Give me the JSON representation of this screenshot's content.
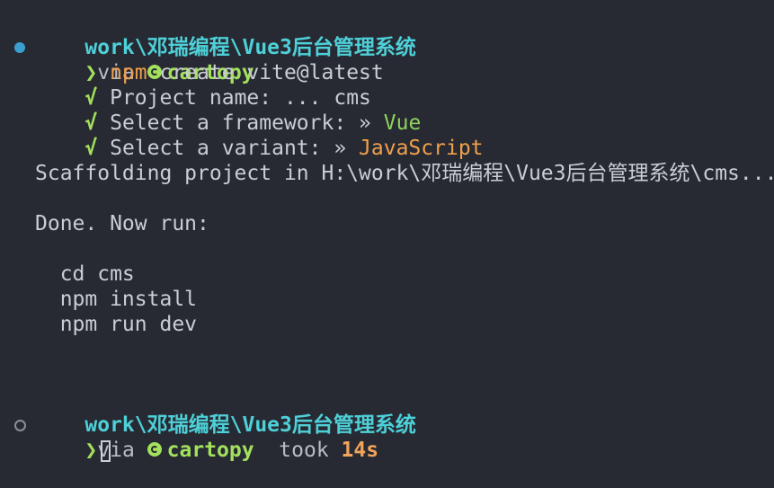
{
  "prompt1": {
    "path": "work\\邓瑞编程\\Vue3后台管理系统",
    "via": "via",
    "env_icon": "python-env-icon",
    "env": "cartopy"
  },
  "cmd": {
    "prompt_char": "❯",
    "program": "npm",
    "args": " create vite@latest"
  },
  "answers": [
    {
      "check": "√",
      "label": " Project name: ... ",
      "value": "cms"
    },
    {
      "check": "√",
      "label": " Select a framework: » ",
      "value": "Vue"
    },
    {
      "check": "√",
      "label": " Select a variant: » ",
      "value": "JavaScript"
    }
  ],
  "output": {
    "scaffolding": "Scaffolding project in H:\\work\\邓瑞编程\\Vue3后台管理系统\\cms...",
    "done": "Done. Now run:",
    "steps": [
      "  cd cms",
      "  npm install",
      "  npm run dev"
    ]
  },
  "prompt2": {
    "path": "work\\邓瑞编程\\Vue3后台管理系统",
    "via": "via",
    "env": "cartopy",
    "took": "took",
    "duration": "14s",
    "prompt_char": "❯"
  },
  "colors": {
    "background": "#272a33",
    "path": "#4ed0d8",
    "env": "#a3e05c",
    "vue": "#8fd15a",
    "javascript": "#f0a04b",
    "npm": "#f0a04b",
    "status_dot": "#3a9fcf"
  }
}
